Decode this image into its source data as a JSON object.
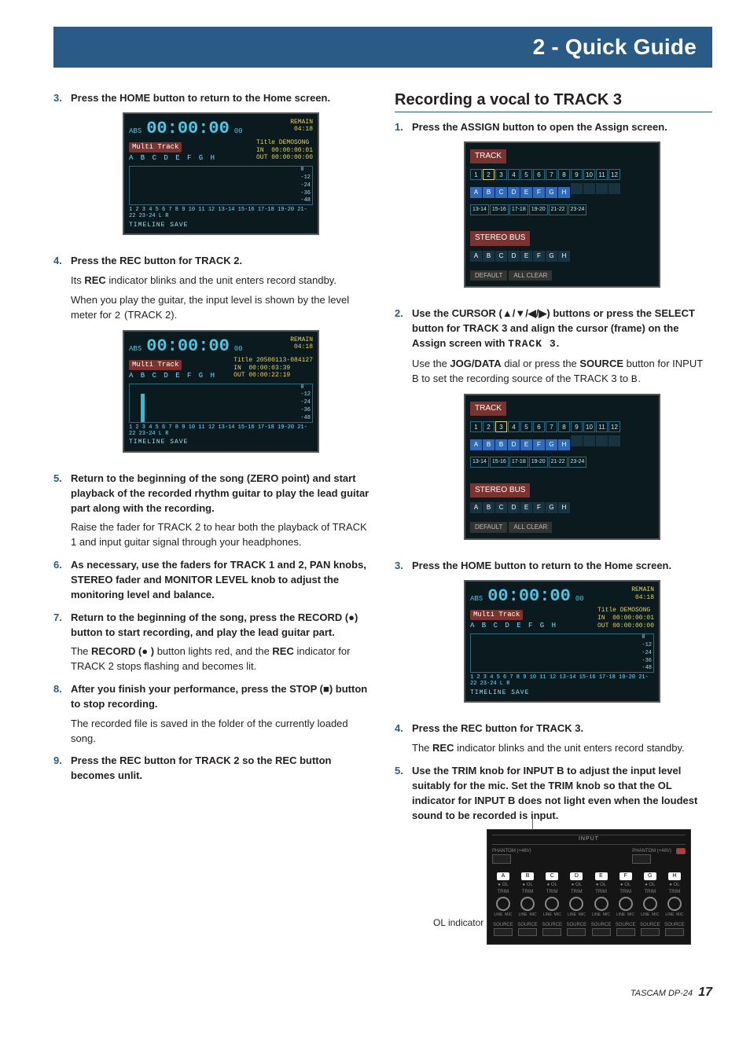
{
  "header": "2 - Quick Guide",
  "left": {
    "step3": {
      "text": "Press the HOME button to return to the Home screen.",
      "lcd": {
        "abs": "ABS",
        "time": "00:00:00",
        "sub": "00",
        "remain_lbl": "REMAIN",
        "remain": "04:18",
        "mt": "Multi Track",
        "title_lbl": "Title",
        "title": "DEMOSONG",
        "in_lbl": "IN",
        "in": "00:00:00:01",
        "out_lbl": "OUT",
        "out": "00:00:00:00",
        "letters": "A B C D E F G H",
        "ticks": [
          "0",
          "-12",
          "-24",
          "-36",
          "-48"
        ],
        "scale": "1 2 3 4 5 6 7 8 9 10 11 12 13-14 15-16 17-18 19-20 21-22 23-24    L R",
        "bottom": "TIMELINE    SAVE"
      }
    },
    "step4": {
      "title": "Press the REC button for TRACK 2.",
      "p1a": "Its ",
      "p1b": "REC",
      "p1c": " indicator blinks and the unit enters record standby.",
      "p2a": "When you play the guitar, the input level is shown by the level meter for ",
      "p2mono": "2",
      "p2b": " (TRACK 2).",
      "lcd": {
        "abs": "ABS",
        "time": "00:00:00",
        "sub": "00",
        "remain_lbl": "REMAIN",
        "remain": "04:18",
        "mt": "Multi Track",
        "title_lbl": "Title",
        "title": "20500113-084127",
        "in_lbl": "IN",
        "in": "00:00:03:39",
        "out_lbl": "OUT",
        "out": "00:00:22:19",
        "letters": "A B C D E F G H",
        "ticks": [
          "0",
          "-12",
          "-24",
          "-36",
          "-48"
        ],
        "scale": "1 2 3 4 5 6 7 8 9 10 11 12 13-14 15-16 17-18 19-20 21-22 23-24    L R",
        "bottom": "TIMELINE    SAVE"
      }
    },
    "step5": {
      "title": "Return to the beginning of the song (ZERO point) and start playback of the recorded rhythm guitar to play the lead guitar part along with the recording.",
      "p1": "Raise the fader for TRACK 2 to hear both the playback of TRACK 1 and input guitar signal through your headphones."
    },
    "step6": {
      "title": "As necessary, use the faders for TRACK 1 and 2, PAN knobs, STEREO fader and MONITOR LEVEL knob to adjust the monitoring level and balance."
    },
    "step7": {
      "title": "Return to the beginning of the song, press the RECORD (●) button to start recording, and play the lead guitar part.",
      "p1a": "The ",
      "p1b": "RECORD (● )",
      "p1c": " button lights red, and the ",
      "p1d": "REC",
      "p1e": " indicator for TRACK 2 stops flashing and becomes lit."
    },
    "step8": {
      "title": "After you finish your performance, press the STOP (■) button to stop recording.",
      "p1": "The recorded file is saved in the folder of the currently loaded song."
    },
    "step9": {
      "title": "Press the REC button for TRACK 2 so the REC button becomes unlit."
    }
  },
  "right": {
    "section": "Recording a vocal to TRACK 3",
    "step1": {
      "title": "Press the ASSIGN button to open the Assign screen.",
      "assign": {
        "hdr": "TRACK",
        "nums": [
          "1",
          "2",
          "3",
          "4",
          "5",
          "6",
          "7",
          "8",
          "9",
          "10",
          "11",
          "12"
        ],
        "srcs": [
          "A",
          "B",
          "C",
          "D",
          "E",
          "F",
          "G",
          "H"
        ],
        "pairs": [
          "13-14",
          "15-16",
          "17-18",
          "19-20",
          "21-22",
          "23-24"
        ],
        "sbus": "STEREO BUS",
        "bus": [
          "A",
          "B",
          "C",
          "D",
          "E",
          "F",
          "G",
          "H"
        ],
        "btns": [
          "DEFAULT",
          "ALL CLEAR"
        ],
        "sel_idx": 1
      }
    },
    "step2": {
      "title_a": "Use the CURSOR (▲/▼/◀/▶) buttons or press the SELECT button for TRACK 3 and align the cursor (frame) on the Assign screen with ",
      "title_mono": "TRACK 3",
      "title_b": ".",
      "p1a": "Use the ",
      "p1b": "JOG/DATA",
      "p1c": " dial or press the ",
      "p1d": "SOURCE",
      "p1e": " button for INPUT B to set the recording source of the TRACK 3 to ",
      "p1mono": "B",
      "p1f": ".",
      "assign": {
        "hdr": "TRACK",
        "nums": [
          "1",
          "2",
          "3",
          "4",
          "5",
          "6",
          "7",
          "8",
          "9",
          "10",
          "11",
          "12"
        ],
        "srcs": [
          "A",
          "B",
          "B",
          "D",
          "E",
          "F",
          "G",
          "H"
        ],
        "pairs": [
          "13-14",
          "15-16",
          "17-18",
          "19-20",
          "21-22",
          "23-24"
        ],
        "sbus": "STEREO BUS",
        "bus": [
          "A",
          "B",
          "C",
          "D",
          "E",
          "F",
          "G",
          "H"
        ],
        "btns": [
          "DEFAULT",
          "ALL CLEAR"
        ],
        "sel_idx": 2
      }
    },
    "step3": {
      "title": "Press the HOME button to return to the Home screen.",
      "lcd": {
        "abs": "ABS",
        "time": "00:00:00",
        "sub": "00",
        "remain_lbl": "REMAIN",
        "remain": "04:18",
        "mt": "Multi Track",
        "title_lbl": "Title",
        "title": "DEMOSONG",
        "in_lbl": "IN",
        "in": "00:00:00:01",
        "out_lbl": "OUT",
        "out": "00:00:00:00",
        "letters": "A B C D E F G H",
        "ticks": [
          "0",
          "-12",
          "-24",
          "-36",
          "-48"
        ],
        "scale": "1 2 3 4 5 6 7 8 9 10 11 12 13-14 15-16 17-18 19-20 21-22 23-24    L R",
        "bottom": "TIMELINE    SAVE"
      }
    },
    "step4": {
      "title": "Press the REC button for TRACK 3.",
      "p1a": "The ",
      "p1b": "REC",
      "p1c": " indicator blinks and the unit enters record standby."
    },
    "step5": {
      "title": "Use the TRIM knob for INPUT B to adjust the input level suitably for the mic. Set the TRIM knob so that the OL indicator for INPUT B does not light even when the loudest sound to be recorded is input.",
      "caption": "OL indicator",
      "panel": {
        "title": "INPUT",
        "ph_inner": "PHANTOM (+48V)",
        "labs": [
          "A",
          "B",
          "C",
          "D",
          "E",
          "F",
          "G",
          "H"
        ],
        "ol": "● OL",
        "trim": "TRIM",
        "line": "LINE",
        "mic": "MIC",
        "src": "SOURCE"
      }
    }
  },
  "footer": {
    "brand": "TASCAM DP-24",
    "page": "17"
  }
}
